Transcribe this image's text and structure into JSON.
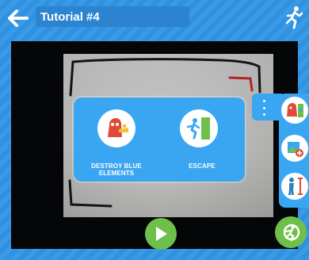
{
  "header": {
    "back_icon": "arrow-left-icon",
    "title": "Tutorial #4",
    "runner_icon": "running-figure-icon"
  },
  "popup": {
    "options": [
      {
        "label": "DESTROY BLUE ELEMENTS",
        "icon": "monster-shoot-icon"
      },
      {
        "label": "ESCAPE",
        "icon": "exit-door-running-icon"
      }
    ]
  },
  "side_panel": {
    "menu_icon": "more-vertical-icon",
    "buttons": [
      {
        "icon": "monster-flee-icon"
      },
      {
        "icon": "add-image-icon"
      },
      {
        "icon": "resize-person-icon"
      }
    ]
  },
  "bottom": {
    "play_icon": "play-icon",
    "exit_icon": "exit-run-icon"
  },
  "colors": {
    "frame_blue": "#2f93e0",
    "panel_blue": "#3aa6f2",
    "play_green": "#6fc04a",
    "icon_red": "#e04a3a"
  }
}
